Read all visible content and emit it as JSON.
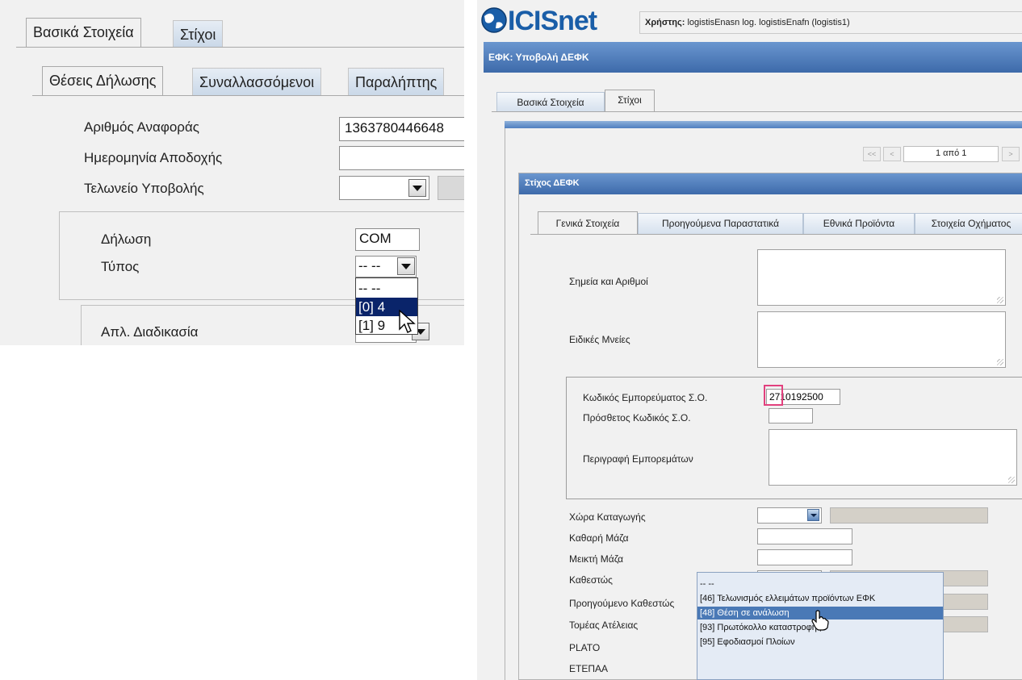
{
  "left": {
    "tabs": [
      "Βασικά Στοιχεία",
      "Στίχοι"
    ],
    "subtabs": [
      "Θέσεις Δήλωσης",
      "Συναλλασσόμενοι",
      "Παραλήπτης"
    ],
    "fields": {
      "reference_label": "Αριθμός Αναφοράς",
      "reference_value": "1363780446648",
      "acceptance_date_label": "Ημερομηνία Αποδοχής",
      "acceptance_date_value": "",
      "office_label": "Τελωνείο Υποβολής"
    },
    "group": {
      "declaration_label": "Δήλωση",
      "declaration_value": "COM",
      "type_label": "Τύπος",
      "type_value": "-- --",
      "type_options": [
        "-- --",
        "[0] 4",
        "[1] 9"
      ],
      "type_selected_index": 1
    },
    "procedure_label": "Απλ. Διαδικασία"
  },
  "right": {
    "logo": "ICISnet",
    "user_label": "Χρήστης:",
    "user_value": "logistisEnasn log. logistisEnafn (logistis1)",
    "page_title": "ΕΦΚ: Υποβολή ΔΕΦΚ",
    "tabs": [
      "Βασικά Στοιχεία",
      "Στίχοι"
    ],
    "pager": {
      "first": "<<",
      "prev": "<",
      "page_text": "1 από 1",
      "next": ">"
    },
    "section_title": "Στίχος ΔΕΦΚ",
    "subtabs": [
      "Γενικά Στοιχεία",
      "Προηγούμενα Παραστατικά",
      "Εθνικά Προϊόντα",
      "Στοιχεία Οχήματος"
    ],
    "fields": {
      "marks_label": "Σημεία και Αριθμοί",
      "notes_label": "Ειδικές Μνείες",
      "commodity_code_label": "Κωδικός Εμπορεύματος Σ.Ο.",
      "commodity_code_value": "2710192500",
      "additional_code_label": "Πρόσθετος Κωδικός Σ.Ο.",
      "description_label": "Περιγραφή Εμπορεμάτων",
      "origin_label": "Χώρα Καταγωγής",
      "net_mass_label": "Καθαρή Μάζα",
      "gross_mass_label": "Μεικτή Μάζα",
      "regime_label": "Καθεστώς",
      "previous_regime_label": "Προηγούμενο Καθεστώς",
      "exemption_label": "Τομέας Ατέλειας",
      "plato_label": "PLATO",
      "etepaa_label": "ΕΤΕΠΑΑ"
    },
    "regime_options": [
      "-- --",
      "[46] Τελωνισμός ελλειμάτων προϊόντων ΕΦΚ",
      "[48] Θέση σε ανάλωση",
      "[93] Πρωτόκολλο καταστροφής",
      "[95] Εφοδιασμοί Πλοίων"
    ],
    "regime_selected_index": 2,
    "colors": {
      "header_bar": "#4f7fbf",
      "highlight_box": "#e2417e",
      "selected_option": "#4a79b6"
    }
  }
}
